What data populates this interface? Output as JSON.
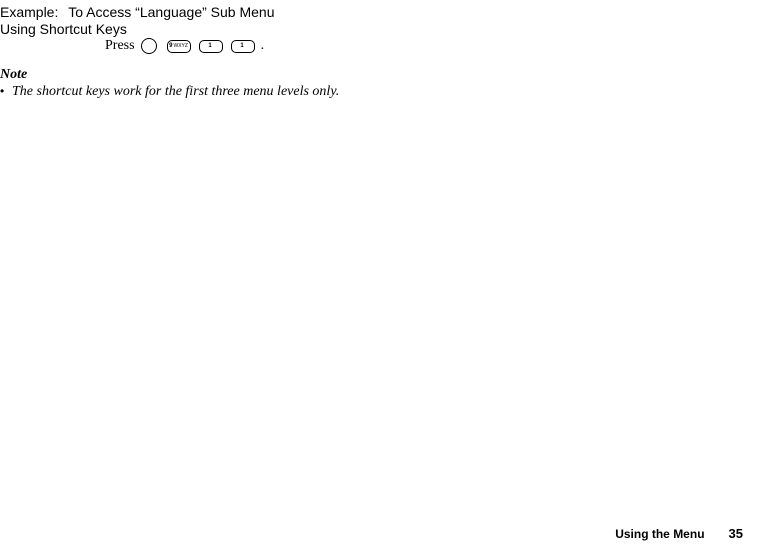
{
  "header": {
    "example_label": "Example:",
    "example_title": "To Access “Language” Sub Menu",
    "subtitle": "Using Shortcut Keys"
  },
  "press_row": {
    "press": "Press",
    "keys": [
      {
        "main": "9",
        "sub": "WXYZ"
      },
      {
        "main": "1",
        "sub": ""
      },
      {
        "main": "1",
        "sub": ""
      }
    ],
    "period": "."
  },
  "note_block": {
    "heading": "Note",
    "bullet": "•",
    "text": "The shortcut keys work for the first three menu levels only."
  },
  "footer": {
    "section": "Using the Menu",
    "page": "35"
  }
}
